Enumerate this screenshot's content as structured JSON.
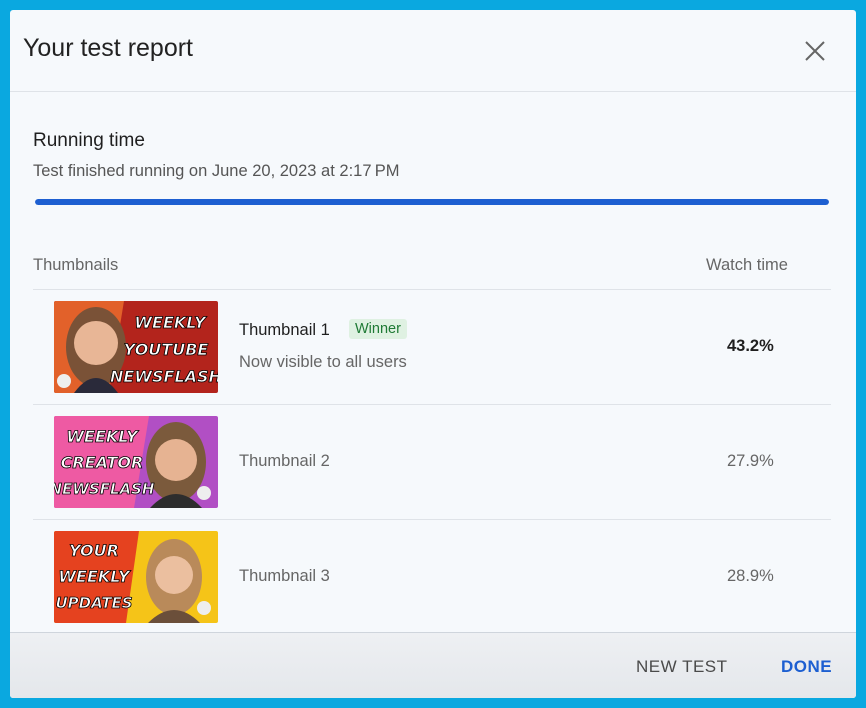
{
  "dialog": {
    "title": "Your test report",
    "close_icon": "close-icon"
  },
  "running": {
    "title": "Running time",
    "subtitle": "Test finished running on June 20, 2023 at 2:17 PM",
    "progress": 1.0
  },
  "table": {
    "col_thumbnails": "Thumbnails",
    "col_watch_time": "Watch time",
    "rows": [
      {
        "name": "Thumbnail 1",
        "badge": "Winner",
        "subtitle": "Now visible to all users",
        "watch_time": "43.2%",
        "thumb_text": [
          "WEEKLY",
          "YOUTUBE",
          "NEWSFLASH"
        ]
      },
      {
        "name": "Thumbnail 2",
        "watch_time": "27.9%",
        "thumb_text": [
          "WEEKLY",
          "CREATOR",
          "NEWSFLASH"
        ]
      },
      {
        "name": "Thumbnail 3",
        "watch_time": "28.9%",
        "thumb_text": [
          "YOUR",
          "WEEKLY",
          "UPDATES"
        ]
      }
    ]
  },
  "footer": {
    "new_test": "NEW TEST",
    "done": "DONE"
  },
  "colors": {
    "accent": "#1d5fd1",
    "frame": "#0aa8e0",
    "winner_bg": "#dff1e2",
    "winner_text": "#1f7a35"
  }
}
